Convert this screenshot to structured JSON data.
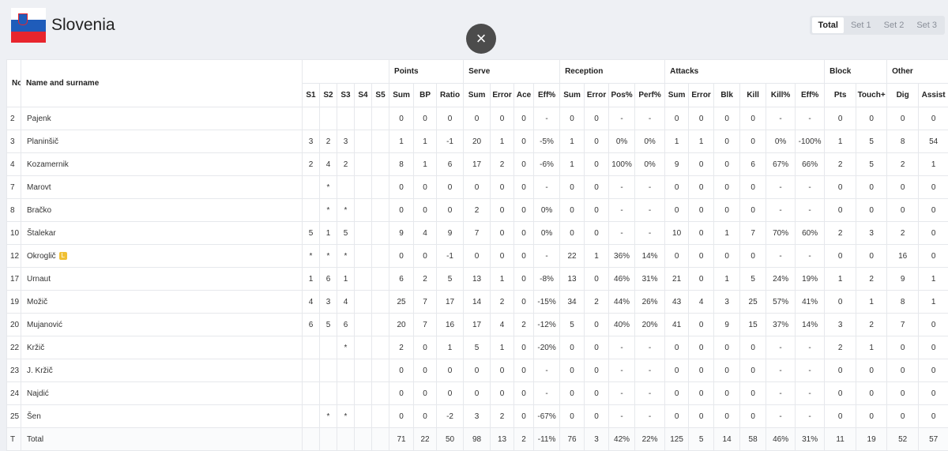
{
  "team": {
    "name": "Slovenia"
  },
  "colors": {
    "flag_white": "#ffffff",
    "flag_blue": "#1f5cba",
    "flag_red": "#e8252d",
    "libero_badge": "#f0c033"
  },
  "close_icon": "×",
  "tabs": [
    {
      "label": "Total",
      "active": true
    },
    {
      "label": "Set 1",
      "active": false
    },
    {
      "label": "Set 2",
      "active": false
    },
    {
      "label": "Set 3",
      "active": false
    }
  ],
  "table": {
    "header": {
      "no": "No",
      "name": "Name and surname",
      "groups": {
        "points": "Points",
        "serve": "Serve",
        "reception": "Reception",
        "attacks": "Attacks",
        "block": "Block",
        "other": "Other"
      },
      "columns": [
        "S1",
        "S2",
        "S3",
        "S4",
        "S5",
        "Sum",
        "BP",
        "Ratio",
        "Sum",
        "Error",
        "Ace",
        "Eff%",
        "Sum",
        "Error",
        "Pos%",
        "Perf%",
        "Sum",
        "Error",
        "Blk",
        "Kill",
        "Kill%",
        "Eff%",
        "Pts",
        "Touch+",
        "Dig",
        "Assist"
      ]
    },
    "rows": [
      {
        "no": "2",
        "name": "Pajenk",
        "libero": "",
        "cells": [
          "",
          "",
          "",
          "",
          "",
          "0",
          "0",
          "0",
          "0",
          "0",
          "0",
          "-",
          "0",
          "0",
          "-",
          "-",
          "0",
          "0",
          "0",
          "0",
          "-",
          "-",
          "0",
          "0",
          "0",
          "0"
        ]
      },
      {
        "no": "3",
        "name": "Planinšič",
        "libero": "",
        "cells": [
          "3",
          "2",
          "3",
          "",
          "",
          "1",
          "1",
          "-1",
          "20",
          "1",
          "0",
          "-5%",
          "1",
          "0",
          "0%",
          "0%",
          "1",
          "1",
          "0",
          "0",
          "0%",
          "-100%",
          "1",
          "5",
          "8",
          "54"
        ]
      },
      {
        "no": "4",
        "name": "Kozamernik",
        "libero": "",
        "cells": [
          "2",
          "4",
          "2",
          "",
          "",
          "8",
          "1",
          "6",
          "17",
          "2",
          "0",
          "-6%",
          "1",
          "0",
          "100%",
          "0%",
          "9",
          "0",
          "0",
          "6",
          "67%",
          "66%",
          "2",
          "5",
          "2",
          "1"
        ]
      },
      {
        "no": "7",
        "name": "Marovt",
        "libero": "",
        "cells": [
          "",
          "*",
          "",
          "",
          "",
          "0",
          "0",
          "0",
          "0",
          "0",
          "0",
          "-",
          "0",
          "0",
          "-",
          "-",
          "0",
          "0",
          "0",
          "0",
          "-",
          "-",
          "0",
          "0",
          "0",
          "0"
        ]
      },
      {
        "no": "8",
        "name": "Bračko",
        "libero": "",
        "cells": [
          "",
          "*",
          "*",
          "",
          "",
          "0",
          "0",
          "0",
          "2",
          "0",
          "0",
          "0%",
          "0",
          "0",
          "-",
          "-",
          "0",
          "0",
          "0",
          "0",
          "-",
          "-",
          "0",
          "0",
          "0",
          "0"
        ]
      },
      {
        "no": "10",
        "name": "Štalekar",
        "libero": "",
        "cells": [
          "5",
          "1",
          "5",
          "",
          "",
          "9",
          "4",
          "9",
          "7",
          "0",
          "0",
          "0%",
          "0",
          "0",
          "-",
          "-",
          "10",
          "0",
          "1",
          "7",
          "70%",
          "60%",
          "2",
          "3",
          "2",
          "0"
        ]
      },
      {
        "no": "12",
        "name": "Okroglič",
        "libero": "L",
        "cells": [
          "*",
          "*",
          "*",
          "",
          "",
          "0",
          "0",
          "-1",
          "0",
          "0",
          "0",
          "-",
          "22",
          "1",
          "36%",
          "14%",
          "0",
          "0",
          "0",
          "0",
          "-",
          "-",
          "0",
          "0",
          "16",
          "0"
        ]
      },
      {
        "no": "17",
        "name": "Urnaut",
        "libero": "",
        "cells": [
          "1",
          "6",
          "1",
          "",
          "",
          "6",
          "2",
          "5",
          "13",
          "1",
          "0",
          "-8%",
          "13",
          "0",
          "46%",
          "31%",
          "21",
          "0",
          "1",
          "5",
          "24%",
          "19%",
          "1",
          "2",
          "9",
          "1"
        ]
      },
      {
        "no": "19",
        "name": "Možič",
        "libero": "",
        "cells": [
          "4",
          "3",
          "4",
          "",
          "",
          "25",
          "7",
          "17",
          "14",
          "2",
          "0",
          "-15%",
          "34",
          "2",
          "44%",
          "26%",
          "43",
          "4",
          "3",
          "25",
          "57%",
          "41%",
          "0",
          "1",
          "8",
          "1"
        ]
      },
      {
        "no": "20",
        "name": "Mujanović",
        "libero": "",
        "cells": [
          "6",
          "5",
          "6",
          "",
          "",
          "20",
          "7",
          "16",
          "17",
          "4",
          "2",
          "-12%",
          "5",
          "0",
          "40%",
          "20%",
          "41",
          "0",
          "9",
          "15",
          "37%",
          "14%",
          "3",
          "2",
          "7",
          "0"
        ]
      },
      {
        "no": "22",
        "name": "Kržič",
        "libero": "",
        "cells": [
          "",
          "",
          "*",
          "",
          "",
          "2",
          "0",
          "1",
          "5",
          "1",
          "0",
          "-20%",
          "0",
          "0",
          "-",
          "-",
          "0",
          "0",
          "0",
          "0",
          "-",
          "-",
          "2",
          "1",
          "0",
          "0"
        ]
      },
      {
        "no": "23",
        "name": "J. Kržič",
        "libero": "",
        "cells": [
          "",
          "",
          "",
          "",
          "",
          "0",
          "0",
          "0",
          "0",
          "0",
          "0",
          "-",
          "0",
          "0",
          "-",
          "-",
          "0",
          "0",
          "0",
          "0",
          "-",
          "-",
          "0",
          "0",
          "0",
          "0"
        ]
      },
      {
        "no": "24",
        "name": "Najdić",
        "libero": "",
        "cells": [
          "",
          "",
          "",
          "",
          "",
          "0",
          "0",
          "0",
          "0",
          "0",
          "0",
          "-",
          "0",
          "0",
          "-",
          "-",
          "0",
          "0",
          "0",
          "0",
          "-",
          "-",
          "0",
          "0",
          "0",
          "0"
        ]
      },
      {
        "no": "25",
        "name": "Šen",
        "libero": "",
        "cells": [
          "",
          "*",
          "*",
          "",
          "",
          "0",
          "0",
          "-2",
          "3",
          "2",
          "0",
          "-67%",
          "0",
          "0",
          "-",
          "-",
          "0",
          "0",
          "0",
          "0",
          "-",
          "-",
          "0",
          "0",
          "0",
          "0"
        ]
      }
    ],
    "total": {
      "no": "T",
      "name": "Total",
      "cells": [
        "",
        "",
        "",
        "",
        "",
        "71",
        "22",
        "50",
        "98",
        "13",
        "2",
        "-11%",
        "76",
        "3",
        "42%",
        "22%",
        "125",
        "5",
        "14",
        "58",
        "46%",
        "31%",
        "11",
        "19",
        "52",
        "57"
      ]
    }
  }
}
